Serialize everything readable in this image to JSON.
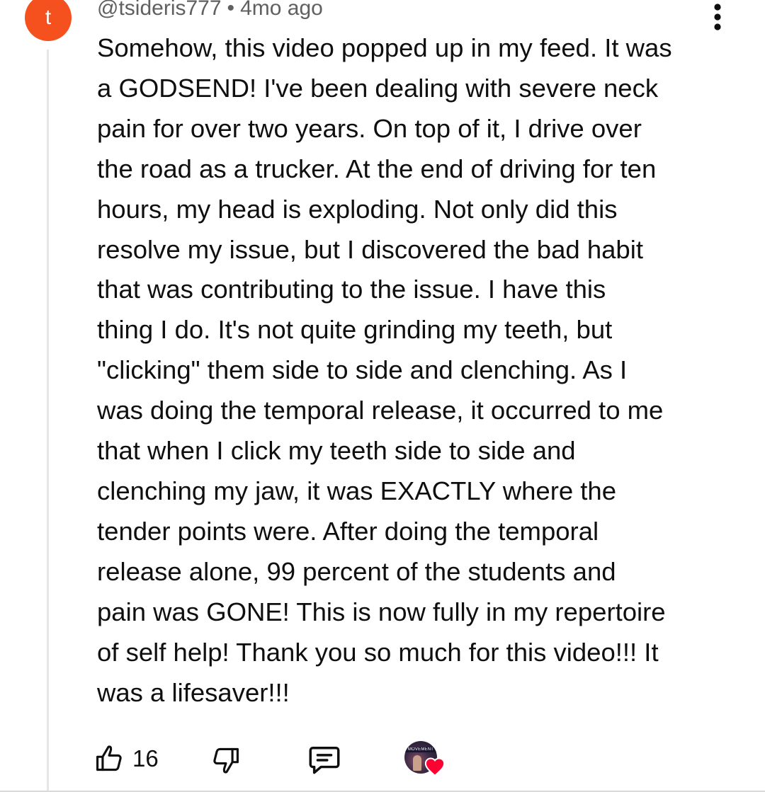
{
  "comment": {
    "avatar_letter": "t",
    "avatar_color": "#f4511e",
    "author": "@tsideris777",
    "separator": "•",
    "timestamp": "4mo ago",
    "text": "Somehow, this video popped up in my feed. It was\na GODSEND! I've been dealing with severe neck\npain for over two years. On top of it, I drive over\nthe road as a trucker. At the end of driving for ten\nhours, my head is exploding. Not only did this\nresolve my issue, but I discovered the bad habit\nthat was contributing to the issue. I have this\nthing I do. It's not quite grinding my teeth, but\n\"clicking\" them side to side and clenching. As I\nwas doing the temporal release, it occurred to me\nthat when I click my teeth side to side and\nclenching my jaw, it was EXACTLY where the\ntender points were. After doing the temporal\nrelease alone, 99 percent of the students and\npain was GONE! This is now fully in my repertoire\nof self help! Thank you so much for this video!!! It\nwas a lifesaver!!!"
  },
  "actions": {
    "like_icon": "thumbs-up-icon",
    "like_count": "16",
    "dislike_icon": "thumbs-down-icon",
    "reply_icon": "comment-reply-icon",
    "creator_heart": {
      "avatar_text": "MOVEMENT",
      "heart_icon": "heart-icon",
      "heart_color": "#ff0033"
    }
  },
  "menu_icon": "more-vertical-icon"
}
